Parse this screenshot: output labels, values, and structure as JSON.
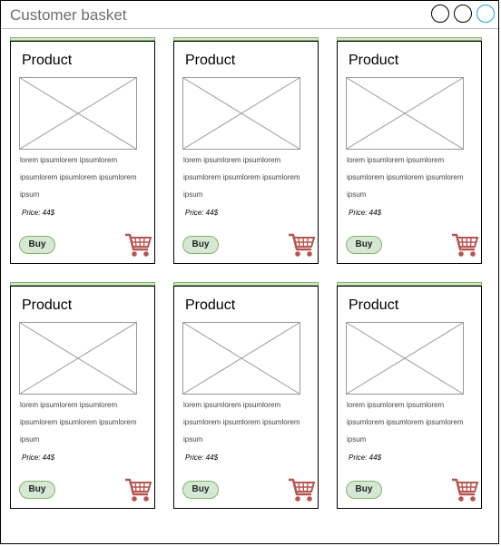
{
  "window": {
    "title": "Customer basket",
    "controls": [
      "circle-button",
      "circle-button",
      "circle-button"
    ]
  },
  "products": [
    {
      "title": "Product",
      "description": "lorem ipsumlorem ipsumlorem ipsumlorem ipsumlorem ipsumlorem ipsum",
      "price": "Price: 44$",
      "buy_label": "Buy",
      "cart_icon": "shopping-cart-icon"
    },
    {
      "title": "Product",
      "description": "lorem ipsumlorem ipsumlorem ipsumlorem ipsumlorem ipsumlorem ipsum",
      "price": "Price: 44$",
      "buy_label": "Buy",
      "cart_icon": "shopping-cart-icon"
    },
    {
      "title": "Product",
      "description": "lorem ipsumlorem ipsumlorem ipsumlorem ipsumlorem ipsumlorem ipsum",
      "price": "Price: 44$",
      "buy_label": "Buy",
      "cart_icon": "shopping-cart-icon"
    },
    {
      "title": "Product",
      "description": "lorem ipsumlorem ipsumlorem ipsumlorem ipsumlorem ipsumlorem ipsum",
      "price": "Price: 44$",
      "buy_label": "Buy",
      "cart_icon": "shopping-cart-icon"
    },
    {
      "title": "Product",
      "description": "lorem ipsumlorem ipsumlorem ipsumlorem ipsumlorem ipsumlorem ipsum",
      "price": "Price: 44$",
      "buy_label": "Buy",
      "cart_icon": "shopping-cart-icon"
    },
    {
      "title": "Product",
      "description": "lorem ipsumlorem ipsumlorem ipsumlorem ipsumlorem ipsumlorem ipsum",
      "price": "Price: 44$",
      "buy_label": "Buy",
      "cart_icon": "shopping-cart-icon"
    }
  ],
  "colors": {
    "accent_fill": "#d5e8d4",
    "accent_border": "#82b366",
    "cart": "#b85450",
    "active_control": "#1ba1e2"
  }
}
